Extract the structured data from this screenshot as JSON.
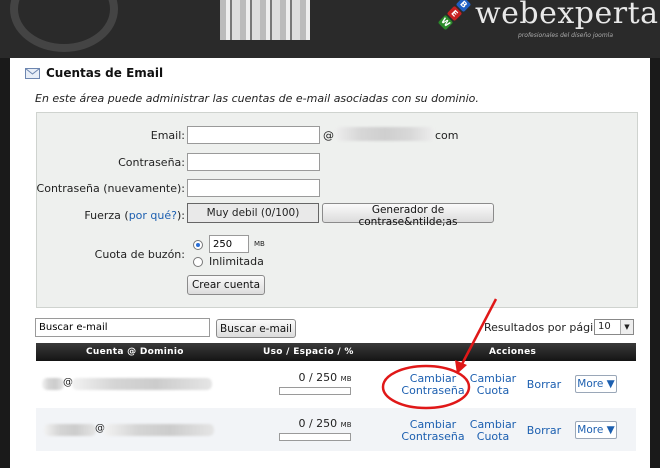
{
  "header": {
    "logo_text": "webexperta",
    "logo_subtitle": "profesionales del diseño joomla",
    "logo_letters": [
      "W",
      "E",
      "B"
    ]
  },
  "page": {
    "title": "Cuentas de Email",
    "intro": "En este área puede administrar las cuentas de e-mail asociadas con su dominio."
  },
  "form": {
    "email_label": "Email:",
    "email_value": "",
    "at_sign": "@",
    "domain_suffix": "com",
    "password_label": "Contraseña:",
    "password_again_label": "Contraseña (nuevamente):",
    "strength_label_prefix": "Fuerza (",
    "strength_link": "por qué?",
    "strength_label_suffix": "):",
    "strength_value": "Muy debil (0/100)",
    "generator_button": "Generador de contrase&ntilde;as",
    "quota_label": "Cuota de buzón:",
    "quota_value": "250",
    "quota_unit": "MB",
    "unlimited_label": "Inlimitada",
    "create_button": "Crear cuenta"
  },
  "search": {
    "value": "Buscar e-mail",
    "button": "Buscar e-mail",
    "per_page_label": "Resultados por página:",
    "per_page_value": "10"
  },
  "table": {
    "headers": [
      "Cuenta @ Dominio",
      "Uso / Espacio / %",
      "Acciones"
    ],
    "rows": [
      {
        "account_at": "@",
        "usage": "0 / 250",
        "usage_unit": "MB",
        "usage_percent": 0,
        "change_password": [
          "Cambiar",
          "Contraseña"
        ],
        "change_quota": [
          "Cambiar",
          "Cuota"
        ],
        "delete": "Borrar",
        "more": "More ▼"
      },
      {
        "account_at": "@",
        "usage": "0 / 250",
        "usage_unit": "MB",
        "usage_percent": 0,
        "change_password": [
          "Cambiar",
          "Contraseña"
        ],
        "change_quota": [
          "Cambiar",
          "Cuota"
        ],
        "delete": "Borrar",
        "more": "More ▼"
      }
    ]
  },
  "colors": {
    "link": "#1c5fb0",
    "annotation": "#e01818",
    "header_bg": "#2a2a2a",
    "table_header_bg": "#1f1f1f"
  }
}
